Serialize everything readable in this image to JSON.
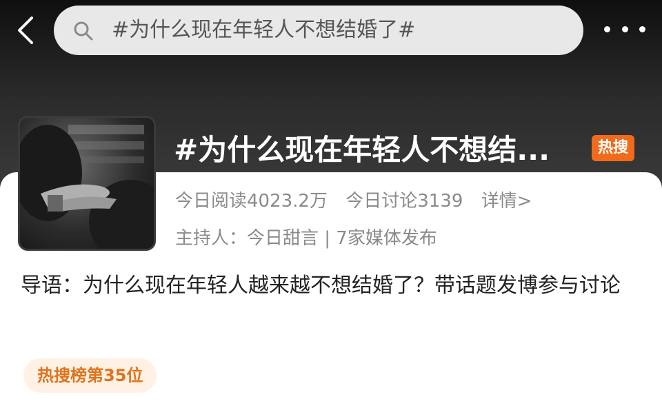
{
  "header": {
    "search_text": "#为什么现在年轻人不想结婚了#"
  },
  "topic": {
    "title": "#为什么现在年轻人不想结...",
    "badge": "热搜",
    "reads": "今日阅读4023.2万",
    "discussions": "今日讨论3139",
    "details_link": "详情>",
    "host": "主持人：今日甜言 | 7家媒体发布"
  },
  "intro": {
    "text": "导语：为什么现在年轻人越来越不想结婚了？带话题发博参与讨论"
  },
  "rank": {
    "label": "热搜榜第35位"
  },
  "colors": {
    "accent": "#f26a1b",
    "rank_bg": "#fff1e3",
    "rank_text": "#e0731d"
  }
}
